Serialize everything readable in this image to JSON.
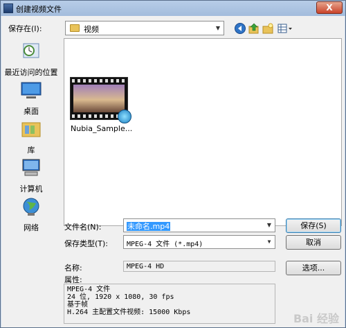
{
  "window": {
    "title": "创建视频文件",
    "close_label": "X"
  },
  "save_in": {
    "label": "保存在(I):",
    "value": "视频"
  },
  "toolbar": {
    "icons": [
      "back-icon",
      "up-folder-icon",
      "new-folder-icon",
      "view-menu-icon"
    ]
  },
  "sidebar": {
    "items": [
      {
        "label": "最近访问的位置",
        "icon": "recent-places-icon"
      },
      {
        "label": "桌面",
        "icon": "desktop-icon"
      },
      {
        "label": "库",
        "icon": "library-icon"
      },
      {
        "label": "计算机",
        "icon": "computer-icon"
      },
      {
        "label": "网络",
        "icon": "network-icon"
      }
    ]
  },
  "files": [
    {
      "name": "Nubia_Sample...",
      "icon": "video-file-icon"
    }
  ],
  "filename": {
    "label": "文件名(N):",
    "value": "未命名.mp4"
  },
  "save_type": {
    "label": "保存类型(T):",
    "value": "MPEG-4 文件 (*.mp4)"
  },
  "name_field": {
    "label": "名称:",
    "value": "MPEG-4 HD"
  },
  "properties": {
    "label": "属性:",
    "lines": [
      "MPEG-4 文件",
      "24 位, 1920 x 1080, 30 fps",
      "基于帧",
      "H.264 主配置文件视频: 15000 Kbps"
    ]
  },
  "buttons": {
    "save": "保存(S)",
    "cancel": "取消",
    "options": "选项..."
  },
  "watermark": "Bai 经验"
}
